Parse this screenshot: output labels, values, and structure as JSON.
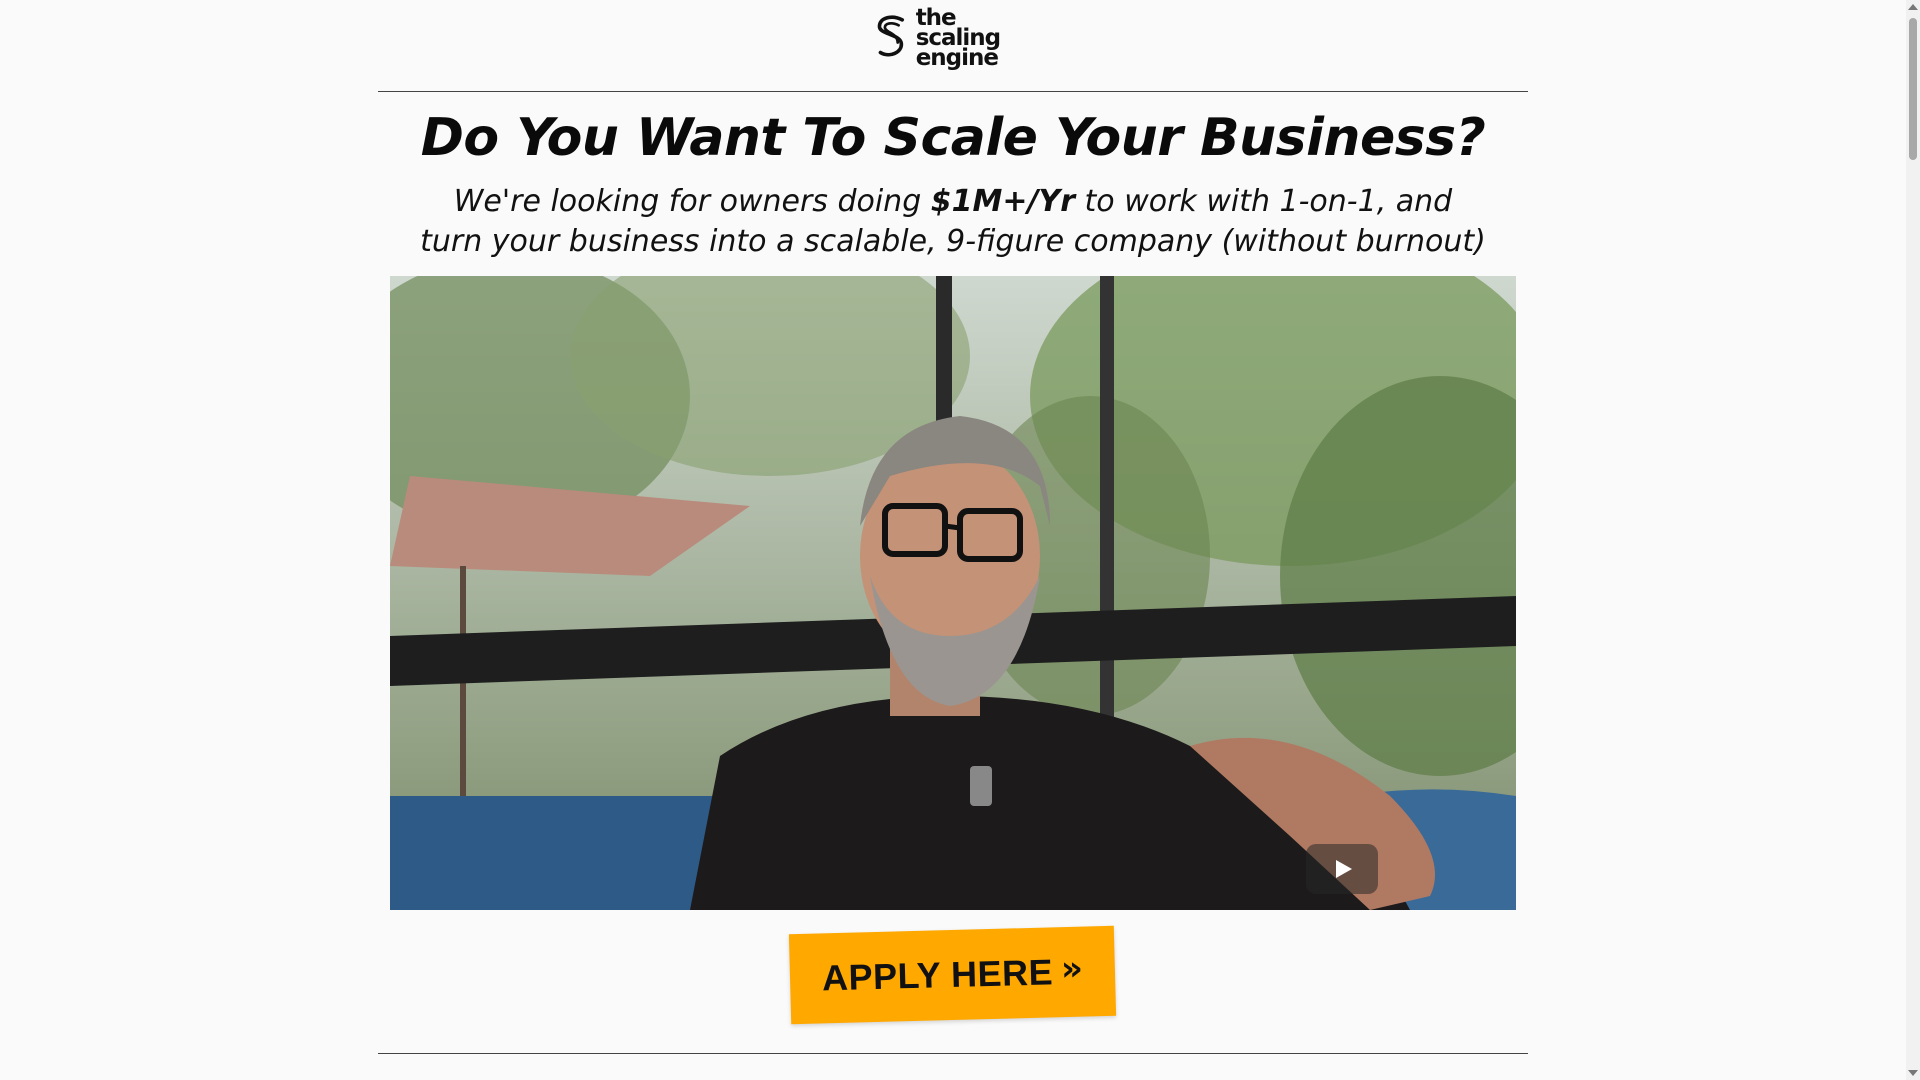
{
  "header": {
    "logo_line1": "the scaling",
    "logo_line2": "engine"
  },
  "hero": {
    "headline": "Do You Want To Scale Your Business?",
    "sub_line1_pre": "We're looking for owners doing ",
    "sub_line1_bold": "$1M+/Yr",
    "sub_line1_post": " to work with 1-on-1, and",
    "sub_line2": "turn your business into a scalable, 9-figure company (without burnout)"
  },
  "video": {
    "play_icon": "play-icon"
  },
  "cta": {
    "label": "APPLY HERE",
    "chevron": "»",
    "color": "#ffa800"
  }
}
